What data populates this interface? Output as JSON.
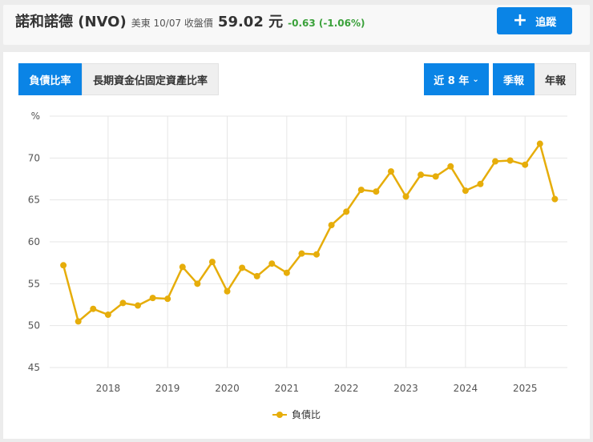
{
  "header": {
    "name": "諾和諾德 (NVO)",
    "market_date": "美東 10/07 收盤價",
    "price": "59.02 元",
    "change": "-0.63 (-1.06%)",
    "track_label": "追蹤",
    "track_icon": "plus-icon"
  },
  "tabs": [
    {
      "label": "負債比率",
      "active": true
    },
    {
      "label": "長期資金佔固定資產比率",
      "active": false
    }
  ],
  "range_select": {
    "label": "近 8 年",
    "icon": "chevron-down-icon"
  },
  "period_tabs": [
    {
      "label": "季報",
      "active": true
    },
    {
      "label": "年報",
      "active": false
    }
  ],
  "colors": {
    "accent": "#0a84e6",
    "series": "#e6ad0a",
    "positive": "#3aa13a"
  },
  "chart_data": {
    "type": "line",
    "title": "",
    "ylabel": "%",
    "xlabel": "",
    "ylim": [
      45,
      75
    ],
    "xlim": [
      2017.02,
      2025.71
    ],
    "yticks": [
      45,
      50,
      55,
      60,
      65,
      70
    ],
    "xticks": [
      2018,
      2019,
      2020,
      2021,
      2022,
      2023,
      2024,
      2025
    ],
    "grid": true,
    "legend_position": "bottom",
    "series": [
      {
        "name": "負債比",
        "x": [
          2017.25,
          2017.5,
          2017.75,
          2018,
          2018.25,
          2018.5,
          2018.75,
          2019,
          2019.25,
          2019.5,
          2019.75,
          2020,
          2020.25,
          2020.5,
          2020.75,
          2021,
          2021.25,
          2021.5,
          2021.75,
          2022,
          2022.25,
          2022.5,
          2022.75,
          2023,
          2023.25,
          2023.5,
          2023.75,
          2024,
          2024.25,
          2024.5,
          2024.75,
          2025,
          2025.25,
          2025.5
        ],
        "values": [
          57.2,
          50.5,
          52.0,
          51.3,
          52.7,
          52.4,
          53.3,
          53.2,
          57.0,
          55.0,
          57.6,
          54.1,
          56.9,
          55.9,
          57.4,
          56.3,
          58.6,
          58.5,
          62.0,
          63.6,
          66.2,
          66.0,
          68.4,
          65.4,
          68.0,
          67.8,
          69.0,
          66.1,
          66.9,
          69.6,
          69.7,
          69.2,
          71.7,
          65.1
        ]
      }
    ]
  }
}
